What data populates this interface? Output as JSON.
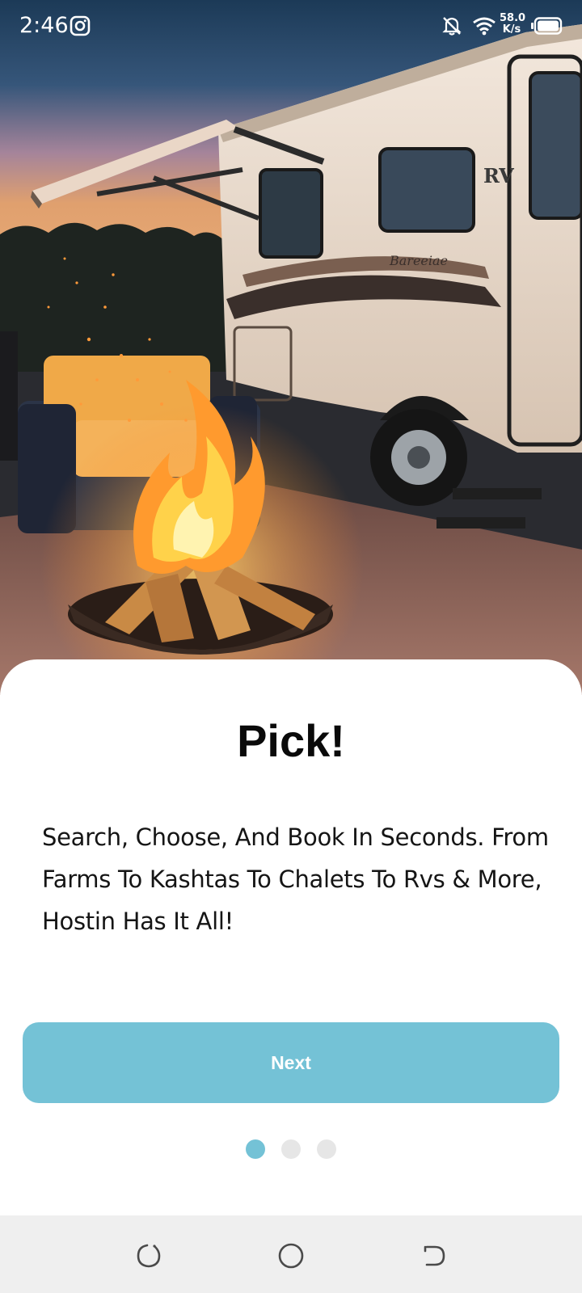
{
  "status_bar": {
    "time": "2:46",
    "net_speed_value": "58.0",
    "net_speed_unit": "K/s",
    "icons": [
      "instagram-icon",
      "bell-off-icon",
      "wifi-icon",
      "battery-icon"
    ]
  },
  "hero": {
    "rv_badge": "RV",
    "rv_brand": "Bareeiae"
  },
  "onboarding": {
    "title": "Pick!",
    "description": "Search, Choose, And Book In Seconds. From Farms To Kashtas To Chalets To Rvs & More, Hostin Has It All!",
    "next_label": "Next",
    "page_count": 3,
    "active_page": 1
  },
  "colors": {
    "accent": "#74c2d6",
    "dot_inactive": "#e6e6e6",
    "nav_bar": "#efefef"
  },
  "nav_bar": {
    "icons": [
      "back-icon",
      "home-icon",
      "recent-apps-icon"
    ]
  }
}
